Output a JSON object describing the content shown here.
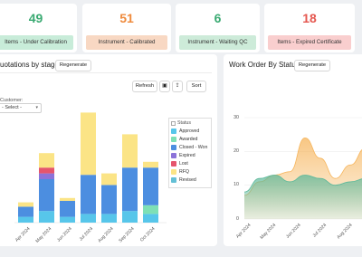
{
  "kpis": [
    {
      "value": "49",
      "label": "Items - Under Calibration",
      "value_color": "#3aaa72",
      "label_bg": "#c8ecd9"
    },
    {
      "value": "51",
      "label": "Instrument - Calibrated",
      "value_color": "#ef8a3c",
      "label_bg": "#f8d8c3"
    },
    {
      "value": "6",
      "label": "Instrument - Waiting QC",
      "value_color": "#3aaa72",
      "label_bg": "#cdebd9"
    },
    {
      "value": "18",
      "label": "Items - Expired Certificate",
      "value_color": "#e5574f",
      "label_bg": "#f9cece"
    }
  ],
  "left_panel": {
    "title": "uotations by stage",
    "regenerate_label": "Regenerate",
    "refresh_label": "Refresh",
    "sort_label": "Sort",
    "customer_label": "Customer:",
    "customer_value": "- Select -",
    "legend_title": "Status"
  },
  "right_panel": {
    "title": "Work Order By Status",
    "regenerate_label": "Regenerate"
  },
  "chart_data": [
    {
      "type": "bar",
      "stacked": true,
      "categories": [
        "Apr 2024",
        "May 2024",
        "Jun 2024",
        "Jul 2024",
        "Aug 2024",
        "Sep 2024",
        "Oct 2024"
      ],
      "series": [
        {
          "name": "Approved",
          "color": "#57c6ea",
          "values": [
            4,
            8,
            4,
            6,
            6,
            8,
            6
          ]
        },
        {
          "name": "Awarded",
          "color": "#7ee0b5",
          "values": [
            0,
            0,
            0,
            0,
            0,
            0,
            6
          ]
        },
        {
          "name": "Closed - Won",
          "color": "#4c8ee0",
          "values": [
            7,
            22,
            11,
            27,
            20,
            30,
            26
          ]
        },
        {
          "name": "Expired",
          "color": "#8c73d9",
          "values": [
            0,
            4,
            0,
            0,
            0,
            0,
            0
          ]
        },
        {
          "name": "Lost",
          "color": "#e5556d",
          "values": [
            0,
            4,
            0,
            0,
            0,
            0,
            0
          ]
        },
        {
          "name": "RFQ",
          "color": "#fbe486",
          "values": [
            3,
            10,
            2,
            43,
            8,
            23,
            4
          ]
        },
        {
          "name": "Revised",
          "color": "#64c0d6",
          "values": [
            0,
            0,
            0,
            0,
            0,
            0,
            0
          ]
        }
      ],
      "ylim": [
        0,
        80
      ],
      "legend_position": "right"
    },
    {
      "type": "area",
      "x": [
        "Apr 2024",
        "May 2024",
        "Jun 2024",
        "Jul 2024",
        "Aug 2024",
        "Sep 2024"
      ],
      "y_ticks": [
        0,
        10,
        20,
        30
      ],
      "ylim": [
        0,
        30
      ],
      "series": [
        {
          "color": "#f6b45a",
          "values": [
            7,
            11,
            13,
            14,
            24,
            18,
            12,
            16,
            21
          ]
        },
        {
          "color": "#5db89a",
          "values": [
            8,
            12,
            13,
            11,
            13,
            12,
            10,
            11,
            12
          ]
        }
      ]
    }
  ]
}
